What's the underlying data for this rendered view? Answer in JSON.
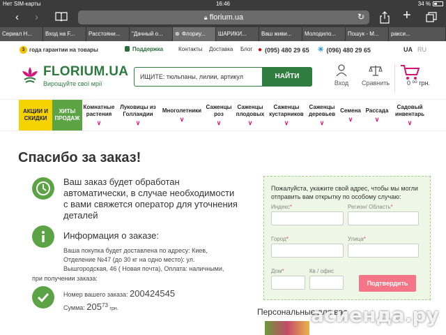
{
  "status_bar": {
    "carrier": "Нет SIM-карты",
    "time": "16:46",
    "battery": "34 %"
  },
  "browser": {
    "url": "florium.ua",
    "reload_icon": "reload-icon"
  },
  "tabs": [
    {
      "label": "Сериал Н..."
    },
    {
      "label": "Вход на F..."
    },
    {
      "label": "Расстояни..."
    },
    {
      "label": "\"Дачный о..."
    },
    {
      "label": "Флориу..."
    },
    {
      "label": "ШАРИКИ..."
    },
    {
      "label": "Ваш живи..."
    },
    {
      "label": "Молодило..."
    },
    {
      "label": "Пошук - М..."
    },
    {
      "label": "ракси..."
    }
  ],
  "infobar": {
    "guarantee_num": "3",
    "guarantee": "года гарантии на товары",
    "support": "Поддержка",
    "contacts": "Контакты",
    "delivery": "Доставка",
    "blog": "Блог",
    "phone1": "(095) 480 29 65",
    "phone2": "(096) 480 29 65",
    "lang_ua": "UA",
    "lang_ru": "RU"
  },
  "header": {
    "brand": "FLORIUM.UA",
    "tagline": "Вирощуйте свої мрії",
    "search_placeholder": "ИЩИТЕ: тюльпаны, лилии, артикул",
    "search_button": "НАЙТИ",
    "login": "Вход",
    "compare": "Сравнить",
    "cart_count": "0",
    "cart_sum": "0 ⁰⁰ грн."
  },
  "menu": [
    {
      "label": "АКЦИИ И СКИДКИ"
    },
    {
      "label": "ХИТЫ ПРОДАЖ"
    },
    {
      "label": "Комнатные растения"
    },
    {
      "label": "Луковицы из Голландии"
    },
    {
      "label": "Многолетники"
    },
    {
      "label": "Саженцы роз"
    },
    {
      "label": "Саженцы плодовых"
    },
    {
      "label": "Саженцы кустарников"
    },
    {
      "label": "Саженцы деревьев"
    },
    {
      "label": "Семена"
    },
    {
      "label": "Рассада"
    },
    {
      "label": "Садовый инвентарь"
    }
  ],
  "main": {
    "title": "Спасибо за заказ!",
    "processing_text": "Ваш заказ будет обработан автоматически, в случае необходимости с вами свяжется оператор для уточнения деталей",
    "order_info_title": "Информация о заказе:",
    "delivery_text_1": "Ваша покупка будет доставлена по адресу: Киев,",
    "delivery_text_2": "Отделение №47 (до 30 кг на одно место): ул.",
    "delivery_text_3": "Вышгородская, 46 ( Новая почта), Оплата: наличными,",
    "delivery_text_4": "при получении заказа:",
    "order_number_label": "Номер вашего заказа:",
    "order_number": "200424545",
    "sum_label": "Сумма:",
    "sum_value": "205",
    "sum_cents": "73",
    "sum_currency": "грн."
  },
  "form": {
    "note": "Пожалуйста, укажите свой адрес, чтобы мы могли отправить вам открытку по особому случаю:",
    "index": "Индекс",
    "region": "Регион/ Область",
    "city": "Город",
    "street": "Улица",
    "house": "Дом",
    "apt": "Кв / офис",
    "confirm": "Подтвердить"
  },
  "personal_label": "Персональные для вас",
  "watermark": "асиенда.ру"
}
